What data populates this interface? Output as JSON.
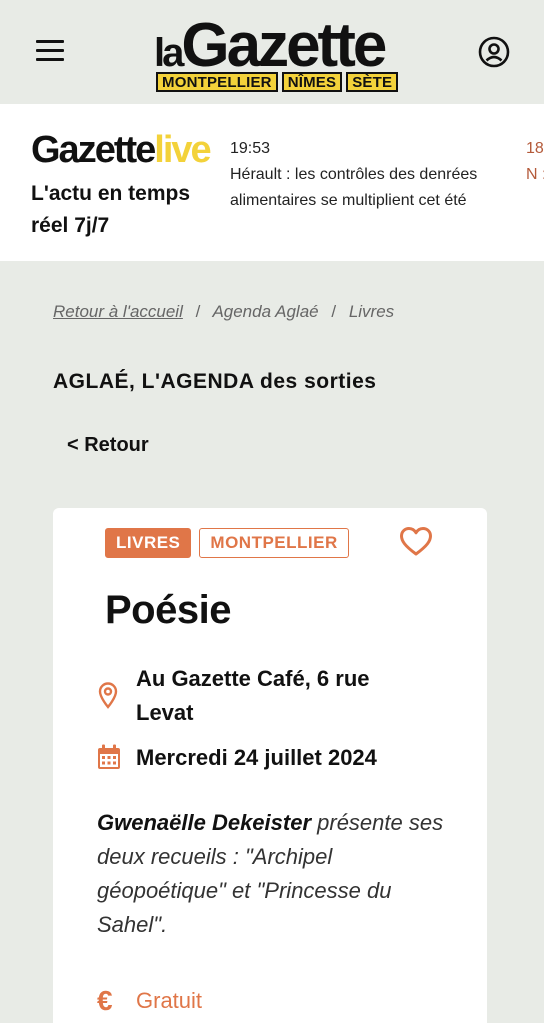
{
  "header": {
    "logo_la": "la",
    "logo_gazette": "Gazette",
    "cities": [
      "MONTPELLIER",
      "NÎMES",
      "SÈTE"
    ]
  },
  "live": {
    "logo_gazette": "Gazette",
    "logo_live": "live",
    "tagline": "L'actu en temps réel 7j/7",
    "items": [
      {
        "time": "19:53",
        "headline": "Hérault : les contrôles des denrées alimentaires se multiplient cet été"
      },
      {
        "time": "18",
        "headline": "N : l kı"
      }
    ]
  },
  "breadcrumb": {
    "home": "Retour à l'accueil",
    "sep": "/",
    "level2": "Agenda Aglaé",
    "level3": "Livres"
  },
  "section_title": "AGLAÉ, L'AGENDA des sorties",
  "back_label": "< Retour",
  "event": {
    "category": "LIVRES",
    "city": "MONTPELLIER",
    "title": "Poésie",
    "location": "Au Gazette Café, 6 rue Levat",
    "date": "Mercredi 24 juillet 2024",
    "author": "Gwenaëlle Dekeister",
    "description": " présente ses deux recueils : \"Archipel géopoétique\" et \"Princesse du Sahel\".",
    "price_symbol": "€",
    "price": "Gratuit"
  },
  "colors": {
    "accent": "#e07648",
    "brand_yellow": "#f3d23a",
    "background": "#e8ebe6"
  },
  "icons": [
    "menu-icon",
    "account-icon",
    "heart-icon",
    "location-pin-icon",
    "calendar-icon",
    "euro-icon"
  ]
}
